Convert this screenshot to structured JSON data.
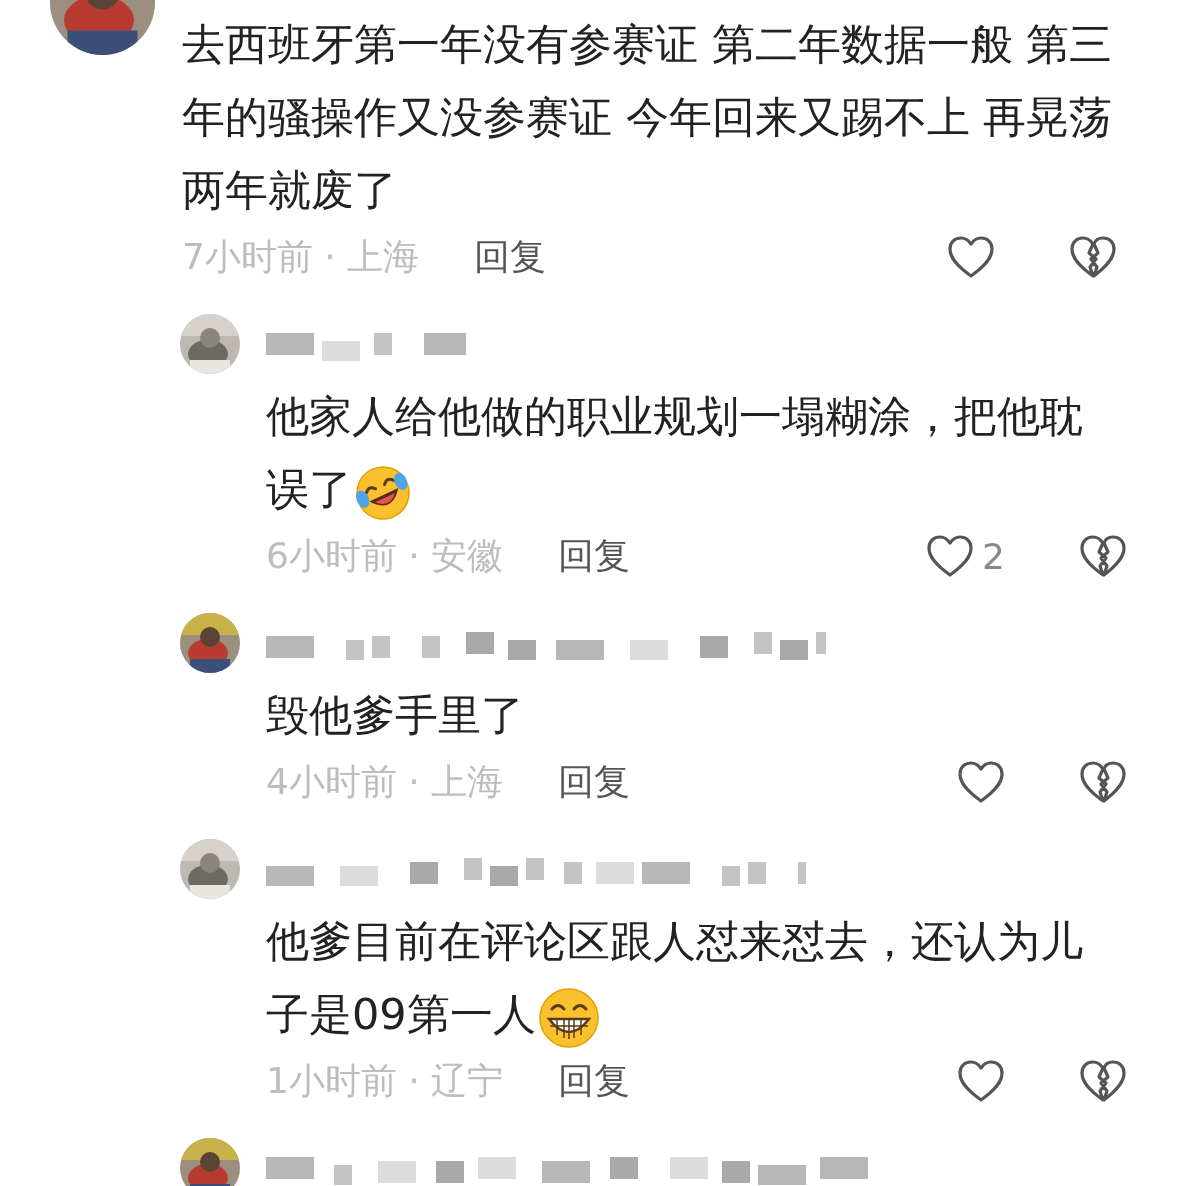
{
  "top_comment": {
    "text": "去西班牙第一年没有参赛证 第二年数据一般 第三年的骚操作又没参赛证 今年回来又踢不上 再晃荡两年就废了",
    "time": "7小时前 · 上海",
    "reply": "回复"
  },
  "replies": [
    {
      "kind": "full",
      "text": "他家人给他做的职业规划一塌糊涂，把他耽误了",
      "emoji": {
        "kind": "laughing"
      },
      "time": "6小时前 · 安徽",
      "reply": "回复",
      "likes": "2"
    },
    {
      "kind": "full",
      "text": "毁他爹手里了",
      "time": "4小时前 · 上海",
      "reply": "回复"
    },
    {
      "kind": "full",
      "text": "他爹目前在评论区跟人怼来怼去，还认为儿子是09第一人",
      "emoji": {
        "kind": "grinning"
      },
      "time": "1小时前 · 辽宁",
      "reply": "回复"
    },
    {
      "kind": "partial"
    }
  ]
}
